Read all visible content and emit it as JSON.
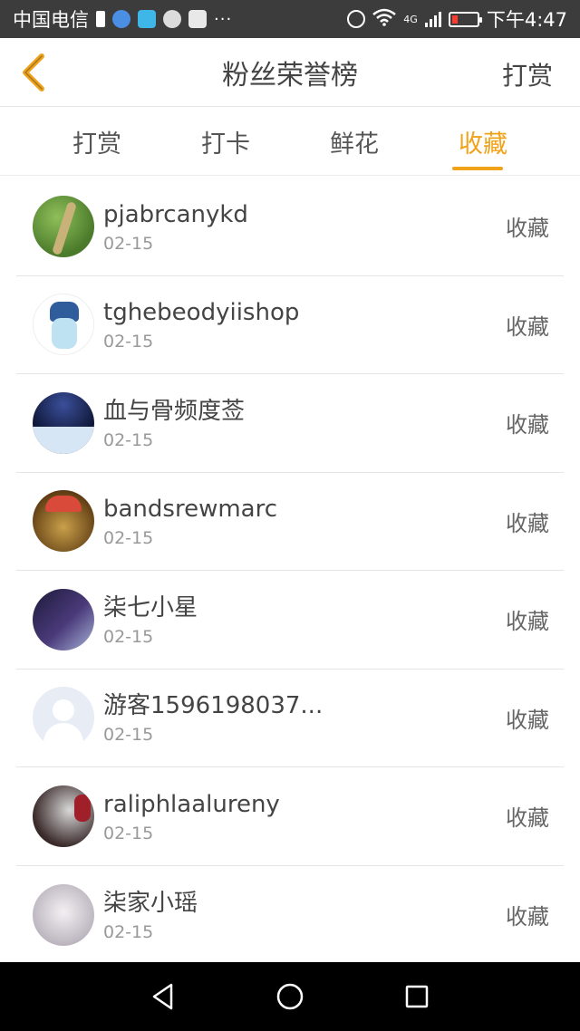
{
  "status_bar": {
    "carrier": "中国电信",
    "dots": "···",
    "network": "4G",
    "time": "下午4:47"
  },
  "header": {
    "title": "粉丝荣誉榜",
    "right_action": "打赏"
  },
  "tabs": [
    {
      "label": "打赏",
      "active": false
    },
    {
      "label": "打卡",
      "active": false
    },
    {
      "label": "鲜花",
      "active": false
    },
    {
      "label": "收藏",
      "active": true
    }
  ],
  "colors": {
    "accent": "#f0a31a",
    "status_bar_bg": "#3c3c3c",
    "system_nav_bg": "#000000"
  },
  "fans": [
    {
      "name": "pjabrcanykd",
      "date": "02-15",
      "action": "收藏"
    },
    {
      "name": "tghebeodyiishop",
      "date": "02-15",
      "action": "收藏"
    },
    {
      "name": "血与骨频度莶",
      "date": "02-15",
      "action": "收藏"
    },
    {
      "name": "bandsrewmarc",
      "date": "02-15",
      "action": "收藏"
    },
    {
      "name": "柒七小星",
      "date": "02-15",
      "action": "收藏"
    },
    {
      "name": "游客1596198037...",
      "date": "02-15",
      "action": "收藏"
    },
    {
      "name": "raliphlaalureny",
      "date": "02-15",
      "action": "收藏"
    },
    {
      "name": "柒家小瑶",
      "date": "02-15",
      "action": "收藏"
    }
  ],
  "icons": {
    "back": "chevron-left-icon",
    "sys_back": "triangle-back-icon",
    "sys_home": "circle-home-icon",
    "sys_recent": "square-recent-icon"
  }
}
